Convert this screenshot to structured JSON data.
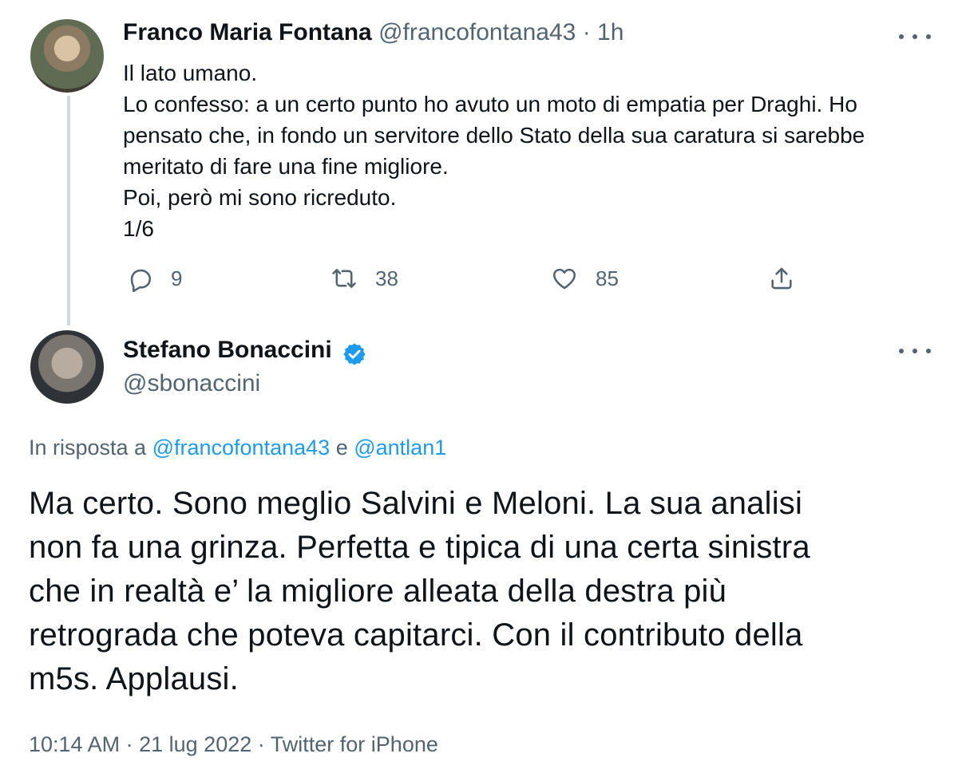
{
  "tweet1": {
    "display_name": "Franco Maria Fontana",
    "handle": "@francofontana43",
    "separator": "·",
    "time": "1h",
    "lines": [
      "Il lato umano.",
      "Lo confesso: a un certo punto ho avuto un moto di empatia per Draghi. Ho",
      "pensato che, in fondo un servitore dello Stato della sua caratura si sarebbe",
      "meritato di fare una fine migliore.",
      "Poi, però mi sono ricreduto.",
      "1/6"
    ],
    "actions": {
      "reply_count": "9",
      "retweet_count": "38",
      "like_count": "85"
    }
  },
  "tweet2": {
    "display_name": "Stefano Bonaccini",
    "handle": "@sbonaccini",
    "reply_to": {
      "prefix": "In risposta a",
      "user1": "@francofontana43",
      "conjunction": "e",
      "user2": "@antlan1"
    },
    "lines": [
      "Ma certo. Sono meglio Salvini e Meloni. La sua analisi",
      "non fa una grinza. Perfetta e tipica di una certa sinistra",
      "che in realtà e’ la migliore alleata della destra più",
      "retrograda che poteva capitarci. Con il contributo della",
      "m5s. Applausi."
    ],
    "meta": {
      "time": "10:14 AM",
      "date": "21 lug 2022",
      "source": "Twitter for iPhone",
      "separator": "·"
    }
  },
  "icons": {
    "reply": "reply-icon",
    "retweet": "retweet-icon",
    "like": "heart-icon",
    "share": "share-icon",
    "more": "more-icon",
    "verified": "verified-badge-icon"
  },
  "colors": {
    "link": "#1d9bf0",
    "muted": "#536471",
    "text": "#0f1419",
    "thread_line": "#cfd9de"
  }
}
